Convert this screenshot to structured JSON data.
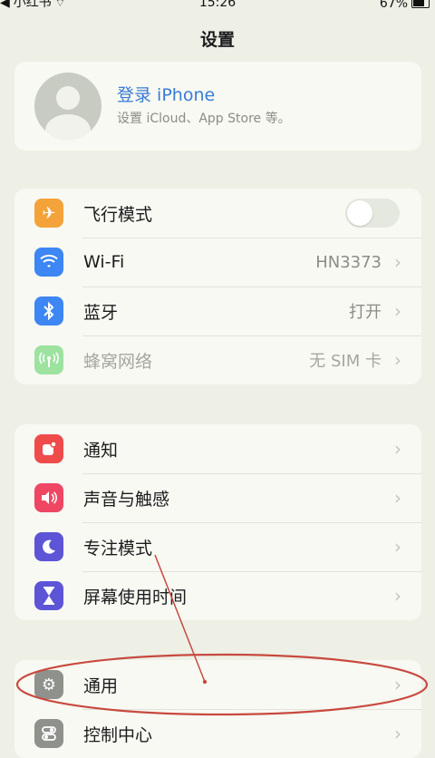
{
  "status": {
    "carrier": "小红书",
    "time": "15:26",
    "battery": "67%"
  },
  "header": {
    "title": "设置"
  },
  "profile": {
    "name": "登录 iPhone",
    "subtitle": "设置 iCloud、App Store 等。"
  },
  "groups": [
    [
      {
        "label": "飞行模式",
        "icon": "airplane-icon",
        "color": "#f3a33a",
        "toggle": true,
        "toggle_on": false
      },
      {
        "label": "Wi-Fi",
        "icon": "wifi-icon",
        "color": "#3d86f4",
        "value": "HN3373"
      },
      {
        "label": "蓝牙",
        "icon": "bluetooth-icon",
        "color": "#3d86f4",
        "value": "打开"
      },
      {
        "label": "蜂窝网络",
        "icon": "cellular-icon",
        "color": "#9ee2a0",
        "value": "无 SIM 卡",
        "dim": true
      }
    ],
    [
      {
        "label": "通知",
        "icon": "notification-icon",
        "color": "#ef4b4b"
      },
      {
        "label": "声音与触感",
        "icon": "sound-icon",
        "color": "#ee4663"
      },
      {
        "label": "专注模式",
        "icon": "moon-icon",
        "color": "#5d55d6"
      },
      {
        "label": "屏幕使用时间",
        "icon": "hourglass-icon",
        "color": "#5d55d6"
      }
    ],
    [
      {
        "label": "通用",
        "icon": "gear-icon",
        "color": "#8e918c"
      },
      {
        "label": "控制中心",
        "icon": "control-center-icon",
        "color": "#8e918c"
      }
    ]
  ]
}
